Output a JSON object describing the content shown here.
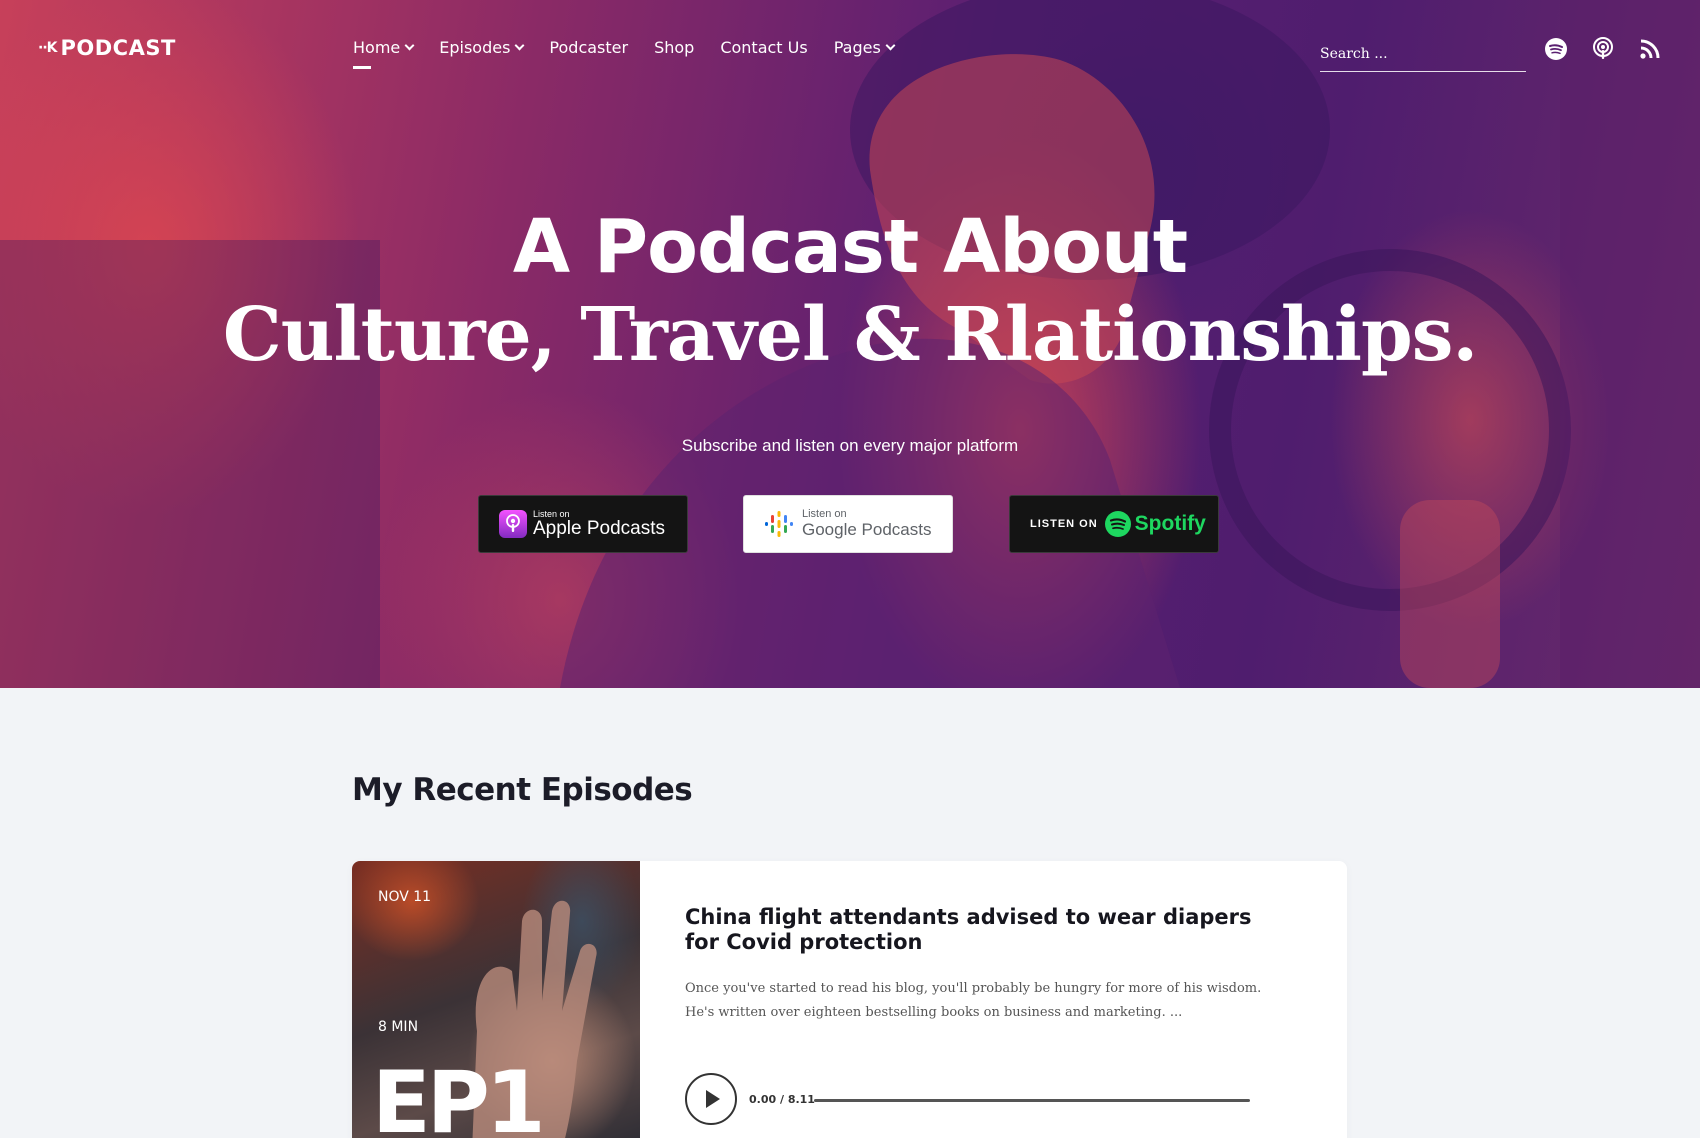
{
  "brand": {
    "logo_mark": "··K",
    "logo_text": "PODCAST"
  },
  "nav": {
    "items": [
      {
        "label": "Home",
        "dropdown": true,
        "active": true
      },
      {
        "label": "Episodes",
        "dropdown": true,
        "active": false
      },
      {
        "label": "Podcaster",
        "dropdown": false,
        "active": false
      },
      {
        "label": "Shop",
        "dropdown": false,
        "active": false
      },
      {
        "label": "Contact Us",
        "dropdown": false,
        "active": false
      },
      {
        "label": "Pages",
        "dropdown": true,
        "active": false
      }
    ]
  },
  "search": {
    "placeholder": "Search ..."
  },
  "social": [
    "spotify-icon",
    "podcast-icon",
    "rss-icon"
  ],
  "hero": {
    "title": "A Podcast About",
    "subtitle": "Culture, Travel & Rlationships.",
    "tagline": "Subscribe and listen on every major platform",
    "badges": [
      {
        "small": "Listen on",
        "big": "Apple Podcasts",
        "icon": "apple-podcasts-icon"
      },
      {
        "small": "Listen on",
        "big": "Google Podcasts",
        "icon": "google-podcasts-icon"
      },
      {
        "small": "LISTEN ON",
        "big": "Spotify",
        "icon": "spotify-icon"
      }
    ]
  },
  "recent": {
    "heading": "My Recent Episodes",
    "episode": {
      "date": "NOV 11",
      "duration": "8 MIN",
      "number": "EP1",
      "title": "China flight attendants advised to wear diapers for Covid protection",
      "excerpt": "Once you've started to read his blog, you'll probably be hungry for more of his wisdom. He's written over eighteen bestselling books on business and marketing. ...",
      "time": "0.00 / 8.11",
      "progress": 0
    }
  },
  "colors": {
    "hero_red": "#d9434f",
    "hero_purple": "#521e70",
    "spotify_green": "#1ed760",
    "page_bg": "#f2f4f7"
  }
}
